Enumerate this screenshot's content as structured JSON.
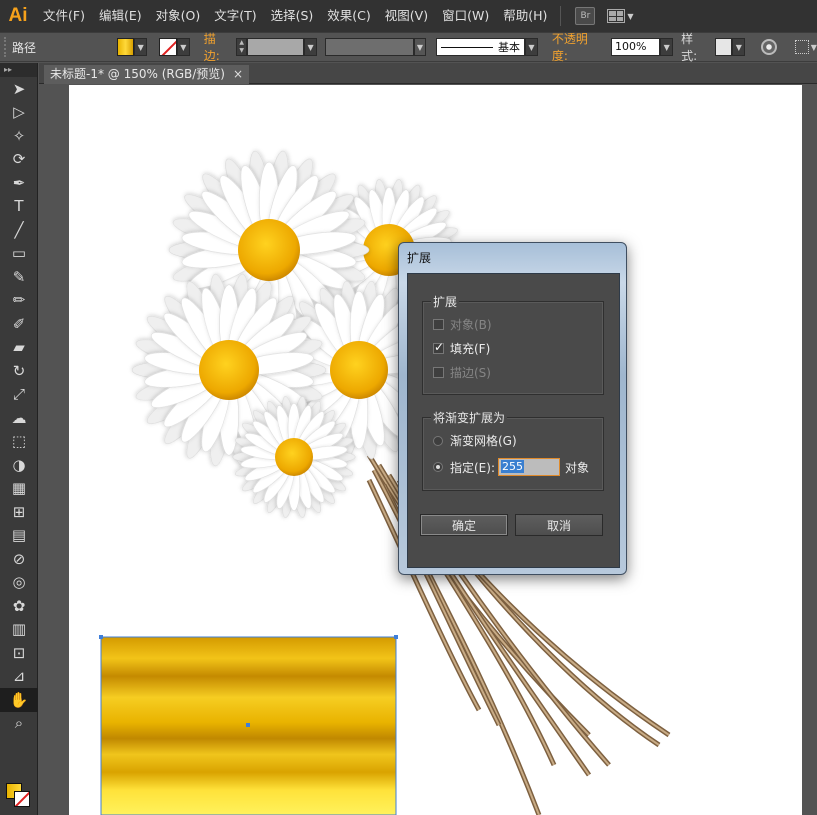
{
  "app": {
    "logo": "Ai"
  },
  "menubar": {
    "items": [
      "文件(F)",
      "编辑(E)",
      "对象(O)",
      "文字(T)",
      "选择(S)",
      "效果(C)",
      "视图(V)",
      "窗口(W)",
      "帮助(H)"
    ],
    "bridge_label": "Br"
  },
  "controlbar": {
    "selection_label": "路径",
    "stroke_label": "描边:",
    "stroke_style_label": "基本",
    "opacity_label": "不透明度:",
    "opacity_value": "100%",
    "style_label": "样式:"
  },
  "document": {
    "tab_title": "未标题-1* @ 150% (RGB/预览)"
  },
  "toolbar": {
    "tools": [
      "selection-tool",
      "direct-selection-tool",
      "magic-wand-tool",
      "lasso-tool",
      "pen-tool",
      "type-tool",
      "line-tool",
      "rectangle-tool",
      "paintbrush-tool",
      "pencil-tool",
      "blob-brush-tool",
      "eraser-tool",
      "rotate-tool",
      "scale-tool",
      "warp-tool",
      "free-transform-tool",
      "shape-builder-tool",
      "perspective-grid-tool",
      "mesh-tool",
      "gradient-tool",
      "eyedropper-tool",
      "blend-tool",
      "symbol-sprayer-tool",
      "column-graph-tool",
      "artboard-tool",
      "slice-tool",
      "hand-tool",
      "zoom-tool"
    ],
    "active_tool": "hand-tool"
  },
  "dialog": {
    "title": "扩展",
    "expand_group": {
      "title": "扩展",
      "options": [
        {
          "label": "对象(B)",
          "checked": false,
          "enabled": false
        },
        {
          "label": "填充(F)",
          "checked": true,
          "enabled": true
        },
        {
          "label": "描边(S)",
          "checked": false,
          "enabled": false
        }
      ]
    },
    "gradient_group": {
      "title": "将渐变扩展为",
      "mesh_label": "渐变网格(G)",
      "specify_label": "指定(E):",
      "specify_value": "255",
      "unit_label": "对象",
      "selected": "specify"
    },
    "ok_label": "确定",
    "cancel_label": "取消"
  },
  "colors": {
    "accent_orange": "#f2a22e",
    "gradient_gold_dark": "#c98f00",
    "gradient_gold_light": "#ffe84a",
    "daisy_center": "#f2b705",
    "stem": "#9a7b55"
  }
}
